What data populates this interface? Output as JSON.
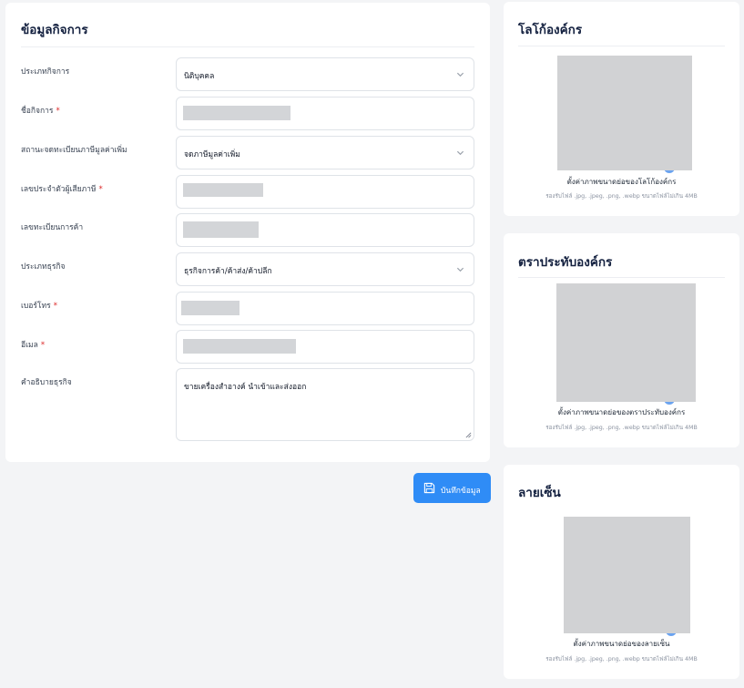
{
  "business_info": {
    "title": "ข้อมูลกิจการ",
    "fields": [
      {
        "label": "ประเภทกิจการ",
        "required": false,
        "value": "นิติบุคคล",
        "kind": "select"
      },
      {
        "label": "ชื่อกิจการ",
        "required": true,
        "value": "",
        "kind": "redacted"
      },
      {
        "label": "สถานะจดทะเบียนภาษีมูลค่าเพิ่ม",
        "required": false,
        "value": "จดภาษีมูลค่าเพิ่ม",
        "kind": "select"
      },
      {
        "label": "เลขประจำตัวผู้เสียภาษี",
        "required": true,
        "value": "",
        "kind": "redacted"
      },
      {
        "label": "เลขทะเบียนการค้า",
        "required": false,
        "value": "",
        "kind": "redacted"
      },
      {
        "label": "ประเภทธุรกิจ",
        "required": false,
        "value": "ธุรกิจการค้า/ค้าส่ง/ค้าปลีก",
        "kind": "select"
      },
      {
        "label": "เบอร์โทร",
        "required": true,
        "value": "",
        "kind": "redacted"
      },
      {
        "label": "อีเมล",
        "required": true,
        "value": "",
        "kind": "redacted"
      },
      {
        "label": "คำอธิบายธุรกิจ",
        "required": false,
        "value": "ขายเครื่องสำอางค์ นำเข้าและส่งออก",
        "kind": "textarea"
      }
    ],
    "required_mark": "*"
  },
  "save_button": {
    "label": "บันทึกข้อมูล",
    "icon": "floppy-disk-icon"
  },
  "side_cards": [
    {
      "title": "โลโก้องค์กร",
      "caption": "ตั้งค่าภาพขนาดย่อของโลโก้องค์กร",
      "hint": "รองรับไฟล์ .jpg, .jpeg, .png, .webp ขนาดไฟล์ไม่เกิน 4MB"
    },
    {
      "title": "ตราประทับองค์กร",
      "caption": "ตั้งค่าภาพขนาดย่อของตราประทับองค์กร",
      "hint": "รองรับไฟล์ .jpg, .jpeg, .png, .webp ขนาดไฟล์ไม่เกิน 4MB"
    },
    {
      "title": "ลายเซ็น",
      "caption": "ตั้งค่าภาพขนาดย่อของลายเซ็น",
      "hint": "รองรับไฟล์ .jpg, .jpeg, .png, .webp ขนาดไฟล์ไม่เกิน 4MB"
    }
  ],
  "colors": {
    "primary": "#2f8cf6",
    "required": "#dc2626",
    "title": "#13203f",
    "background": "#f3f4f6"
  }
}
